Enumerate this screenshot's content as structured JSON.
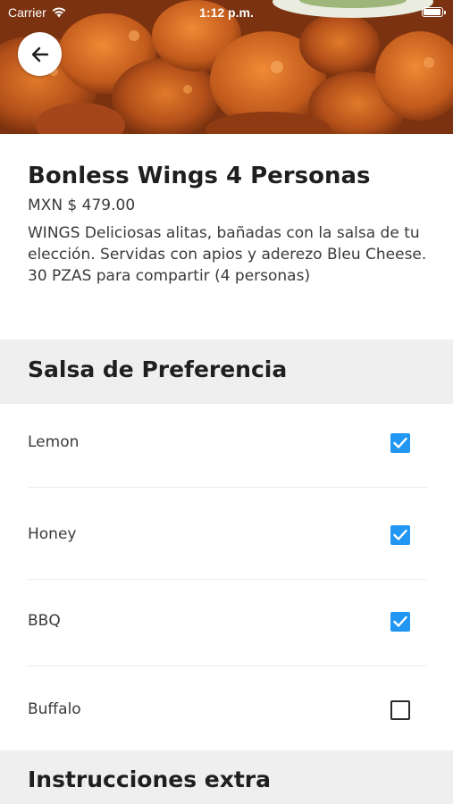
{
  "status_bar": {
    "carrier": "Carrier",
    "time": "1:12 p.m."
  },
  "hero": {
    "image_icon": "fried-chicken-wings-photo"
  },
  "header": {
    "back_icon": "arrow-left-icon"
  },
  "product": {
    "title": "Bonless Wings 4 Personas",
    "price": "MXN $ 479.00",
    "description": "WINGS Deliciosas alitas, bañadas con la salsa de tu elección. Servidas con apios y aderezo Bleu Cheese. 30 PZAS para compartir (4 personas)"
  },
  "sauce_section": {
    "title": "Salsa de Preferencia",
    "options": [
      {
        "label": "Lemon",
        "checked": true
      },
      {
        "label": "Honey",
        "checked": true
      },
      {
        "label": "BBQ",
        "checked": true
      },
      {
        "label": "Buffalo",
        "checked": false
      }
    ]
  },
  "extra_section": {
    "title": "Instrucciones extra"
  },
  "colors": {
    "checkbox_checked": "#2196f3",
    "section_background": "#efefef",
    "title_text": "#1f1f1f",
    "body_text": "#3a3a3a"
  }
}
